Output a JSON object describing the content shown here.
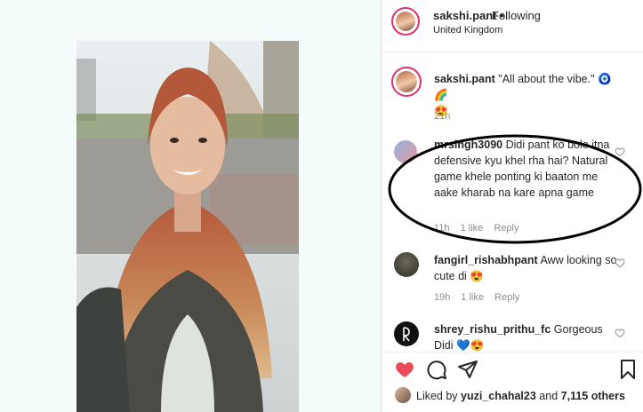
{
  "post": {
    "username": "sakshi.pant",
    "separator": "•",
    "follow_status": "Following",
    "location": "United Kingdom"
  },
  "caption": {
    "username": "sakshi.pant",
    "text": "\"All about the vibe.\" 🧿🌈",
    "emoji_line": "😍",
    "time": "21h"
  },
  "comments": [
    {
      "username": "mrsingh3090",
      "text": "Didi pant ko bolo itna defensive kyu khel rha hai? Natural game khele ponting ki baaton me aake kharab na kare apna game",
      "time": "11h",
      "likes": "1 like",
      "reply": "Reply"
    },
    {
      "username": "fangirl_rishabhpant",
      "text": "Aww looking so cute di 😍",
      "time": "19h",
      "likes": "1 like",
      "reply": "Reply"
    },
    {
      "username": "shrey_rishu_prithu_fc",
      "text": "Gorgeous Didi 💙😍",
      "time": "",
      "likes": "",
      "reply": ""
    }
  ],
  "likes_summary": {
    "prefix": "Liked by",
    "user": "yuzi_chahal23",
    "conj": "and",
    "others": "7,115 others"
  },
  "icons": [
    "heart-icon",
    "comment-icon",
    "share-icon",
    "bookmark-icon",
    "small-heart-icon"
  ],
  "colors": {
    "like_red": "#ed4956",
    "ring": "#e1306c",
    "muted": "#8e8e8e"
  }
}
